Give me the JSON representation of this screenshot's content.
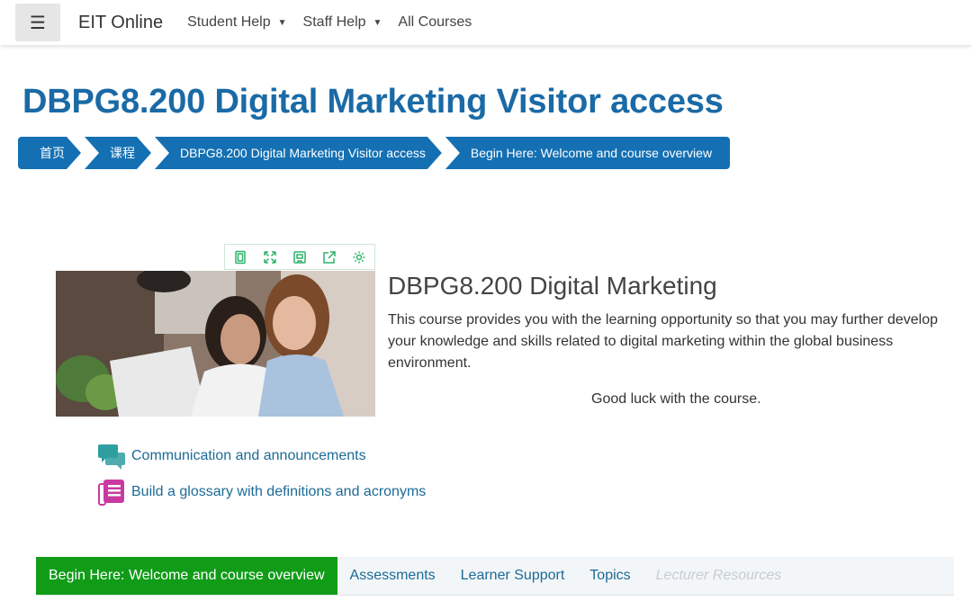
{
  "navbar": {
    "menu_icon": "☰",
    "brand": "EIT Online",
    "items": [
      {
        "label": "Student Help",
        "has_caret": true
      },
      {
        "label": "Staff Help",
        "has_caret": true
      },
      {
        "label": "All Courses",
        "has_caret": false
      }
    ]
  },
  "page": {
    "title": "DBPG8.200 Digital Marketing Visitor access"
  },
  "breadcrumb": [
    "首页",
    "课程",
    "DBPG8.200 Digital Marketing Visitor access",
    "Begin Here: Welcome and course overview"
  ],
  "toolbar": {
    "icons": [
      "fullpage-icon",
      "expand-icon",
      "save-icon",
      "share-icon",
      "gear-icon"
    ],
    "color": "#2eb26b"
  },
  "course": {
    "heading": "DBPG8.200 Digital Marketing",
    "description": "This course provides you with the learning opportunity so that you may further develop your knowledge and skills related to digital marketing within the global business environment.",
    "closing": "Good luck with the course."
  },
  "activities": [
    {
      "icon": "forum-icon",
      "label": "Communication and announcements",
      "color": "#2f9ea0"
    },
    {
      "icon": "glossary-icon",
      "label": "Build a glossary with definitions and acronyms",
      "color": "#c93aa0"
    }
  ],
  "tabs": [
    {
      "label": "Begin Here: Welcome and course overview",
      "active": true
    },
    {
      "label": "Assessments",
      "active": false
    },
    {
      "label": "Learner Support",
      "active": false
    },
    {
      "label": "Topics",
      "active": false
    },
    {
      "label": "Lecturer Resources",
      "active": false,
      "disabled": true
    }
  ],
  "colors": {
    "title": "#1a6aa6",
    "breadcrumb": "#1470b3",
    "link": "#1c6a96",
    "active_tab": "#119c18"
  }
}
